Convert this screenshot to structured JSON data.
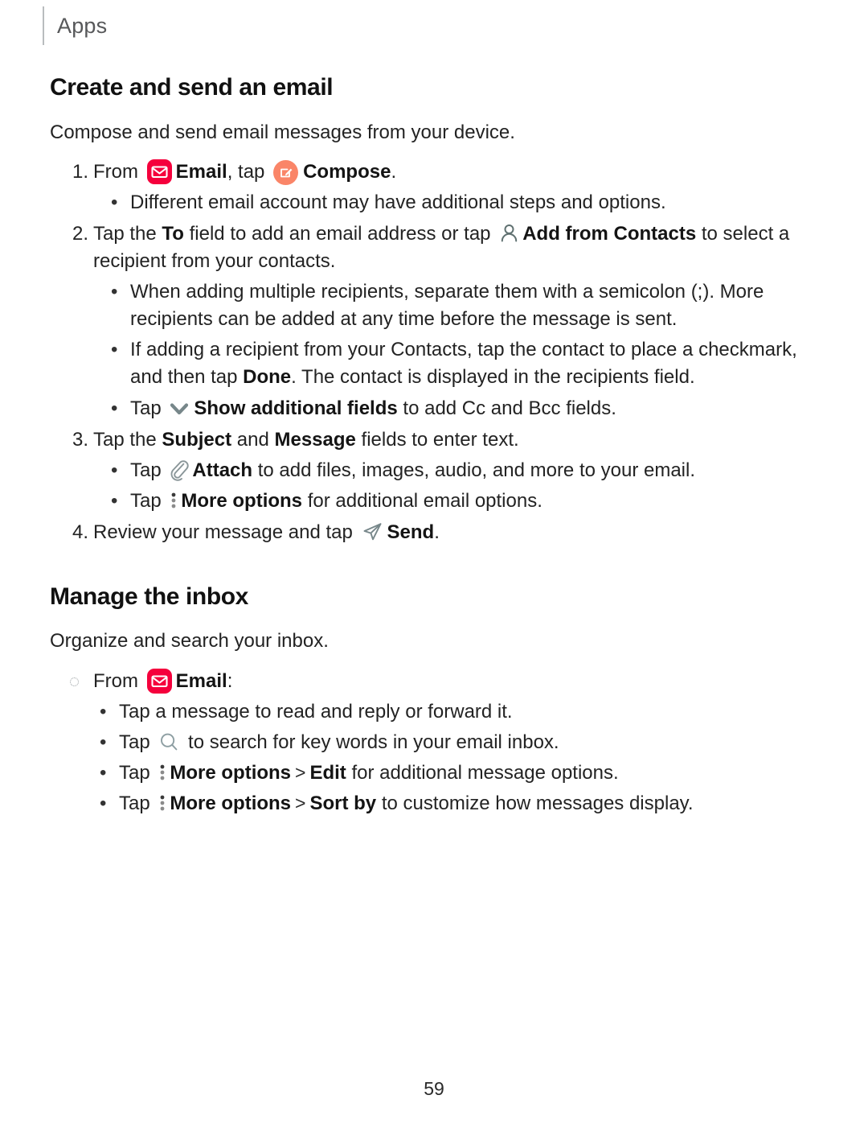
{
  "running_head": {
    "label": "Apps"
  },
  "colors": {
    "email_badge": "#f5003c",
    "compose_badge": "#fa8568",
    "icon_gray": "#6b7a7c",
    "rule_gray": "#b9bcbe",
    "text": "#232323"
  },
  "sections": [
    {
      "title": "Create and send an email",
      "intro": "Compose and send email messages from your device.",
      "steps": [
        {
          "number": "1.",
          "pre": "From",
          "icon": "email-app-icon",
          "bold1": "Email",
          "mid": ", tap",
          "icon2": "compose-icon",
          "bold2": "Compose",
          "post": ".",
          "bullets": [
            {
              "text": "Different email account may have additional steps and options."
            }
          ]
        },
        {
          "number": "2.",
          "pre": "Tap the",
          "bold1": "To",
          "mid": "field to add an email address or tap",
          "icon": "add-from-contacts-icon",
          "bold2": "Add from Contacts",
          "post": "to select a recipient from your contacts.",
          "bullets": [
            {
              "text": "When adding multiple recipients, separate them with a semicolon (;). More recipients can be added at any time before the message is sent."
            },
            {
              "pre": "If adding a recipient from your Contacts, tap the contact to place a checkmark, and then tap",
              "bold": "Done",
              "post": ". The contact is displayed in the recipients field."
            },
            {
              "pre": "Tap",
              "icon": "chevron-down-icon",
              "bold": "Show additional fields",
              "post": "to add Cc and Bcc fields."
            }
          ]
        },
        {
          "number": "3.",
          "pre": "Tap the",
          "bold1": "Subject",
          "mid": "and",
          "bold2": "Message",
          "post": "fields to enter text.",
          "bullets": [
            {
              "pre": "Tap",
              "icon": "attach-icon",
              "bold": "Attach",
              "post": "to add files, images, audio, and more to your email."
            },
            {
              "pre": "Tap",
              "icon": "more-options-icon",
              "bold": "More options",
              "post": "for additional email options."
            }
          ]
        },
        {
          "number": "4.",
          "pre": "Review your message and tap",
          "icon": "send-icon",
          "bold1": "Send",
          "post": "."
        }
      ]
    },
    {
      "title": "Manage the inbox",
      "intro": "Organize and search your inbox.",
      "from_line": {
        "pre": "From",
        "icon": "email-app-icon",
        "bold": "Email",
        "post": ":"
      },
      "bullets": [
        {
          "text": "Tap a message to read and reply or forward it."
        },
        {
          "pre": "Tap",
          "icon": "search-icon",
          "post": "to search for key words in your email inbox."
        },
        {
          "pre": "Tap",
          "icon": "more-options-icon",
          "bold": "More options",
          "sep": ">",
          "bold2": "Edit",
          "post": "for additional message options."
        },
        {
          "pre": "Tap",
          "icon": "more-options-icon",
          "bold": "More options",
          "sep": ">",
          "bold2": "Sort by",
          "post": "to customize how messages display."
        }
      ]
    }
  ],
  "footer": {
    "page_number": "59"
  }
}
